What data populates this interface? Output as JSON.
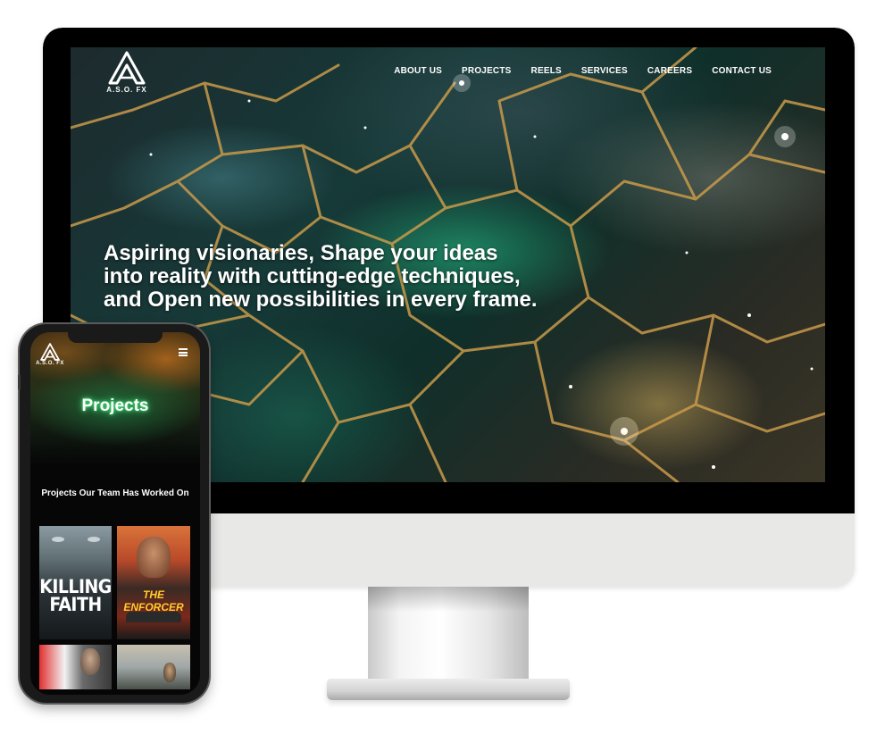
{
  "desktop": {
    "logo_text": "A.S.O. FX",
    "nav": [
      {
        "label": "ABOUT US"
      },
      {
        "label": "PROJECTS"
      },
      {
        "label": "REELS"
      },
      {
        "label": "SERVICES"
      },
      {
        "label": "CAREERS"
      },
      {
        "label": "CONTACT US"
      }
    ],
    "hero_lines": [
      "Aspiring visionaries, Shape your ideas",
      "into reality with cutting-edge techniques,",
      "and Open new possibilities in every frame."
    ]
  },
  "mobile": {
    "logo_text": "A.S.O. FX",
    "page_title": "Projects",
    "section_title": "Projects Our Team Has Worked On",
    "posters": [
      {
        "title": "KILLING FAITH"
      },
      {
        "title": "THE ENFORCER"
      }
    ]
  },
  "icons": {
    "brand_logo": "aso-fx-logo-icon",
    "menu": "hamburger-menu-icon"
  },
  "colors": {
    "brand_glow": "#50ff8c",
    "enforcer_yellow": "#f3d232"
  }
}
